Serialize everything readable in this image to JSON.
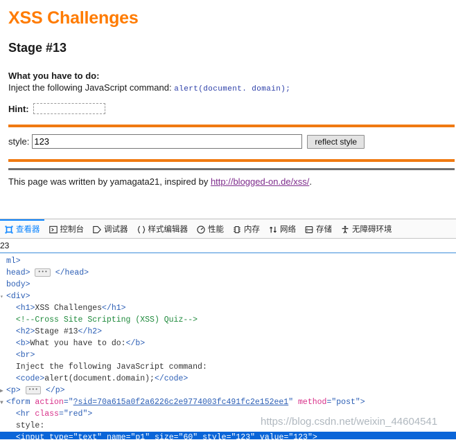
{
  "page": {
    "title": "XSS Challenges",
    "stage": "Stage #13",
    "task_label": "What you have to do:",
    "task_text": "Inject the following JavaScript command:",
    "task_code": "alert(document. domain);",
    "hint_label": "Hint:",
    "hint_value": "",
    "style_label": "style:",
    "style_value": "123",
    "reflect_button": "reflect style",
    "footer_text_before": "This page was written by yamagata21, inspired by ",
    "footer_link": "http://blogged-on.de/xss/",
    "footer_text_after": ".",
    "accent_color": "#ff7b00",
    "rule_red_color": "#f07a12",
    "rule_gray_color": "#6d6e71",
    "link_color": "#7d2b8b"
  },
  "devtools": {
    "tabs": [
      {
        "label": "查看器",
        "icon": "inspector-icon",
        "active": true
      },
      {
        "label": "控制台",
        "icon": "console-icon",
        "active": false
      },
      {
        "label": "调试器",
        "icon": "debugger-icon",
        "active": false
      },
      {
        "label": "样式编辑器",
        "icon": "style-editor-icon",
        "active": false
      },
      {
        "label": "性能",
        "icon": "performance-icon",
        "active": false
      },
      {
        "label": "内存",
        "icon": "memory-icon",
        "active": false
      },
      {
        "label": "网络",
        "icon": "network-icon",
        "active": false
      },
      {
        "label": "存储",
        "icon": "storage-icon",
        "active": false
      },
      {
        "label": "无障碍环境",
        "icon": "accessibility-icon",
        "active": false
      }
    ],
    "active_tab": "查看器",
    "search_value": "23",
    "accent_color": "#0a84ff",
    "selection_color": "#0a65d8",
    "markup": [
      {
        "id": "l1",
        "indent": 0,
        "parts": [
          {
            "t": "tg",
            "s": "ml>"
          }
        ]
      },
      {
        "id": "l2",
        "indent": 0,
        "parts": [
          {
            "t": "tg",
            "s": "head>"
          },
          {
            "t": "badge",
            "s": ""
          },
          {
            "t": "tg",
            "s": "</head>"
          }
        ]
      },
      {
        "id": "l3",
        "indent": 0,
        "parts": [
          {
            "t": "tg",
            "s": "body>"
          }
        ]
      },
      {
        "id": "l4",
        "indent": 0,
        "twisty": "down-dim",
        "parts": [
          {
            "t": "tg",
            "s": "<div>"
          }
        ]
      },
      {
        "id": "l5",
        "indent": 1,
        "parts": [
          {
            "t": "tg",
            "s": "<h1>"
          },
          {
            "t": "txt",
            "s": "XSS Challenges"
          },
          {
            "t": "tg",
            "s": "</h1>"
          }
        ]
      },
      {
        "id": "l6",
        "indent": 1,
        "parts": [
          {
            "t": "cmt",
            "s": "<!--Cross Site Scripting (XSS) Quiz-->"
          }
        ]
      },
      {
        "id": "l7",
        "indent": 1,
        "parts": [
          {
            "t": "tg",
            "s": "<h2>"
          },
          {
            "t": "txt",
            "s": "Stage #13"
          },
          {
            "t": "tg",
            "s": "</h2>"
          }
        ]
      },
      {
        "id": "l8",
        "indent": 1,
        "parts": [
          {
            "t": "tg",
            "s": "<b>"
          },
          {
            "t": "txt",
            "s": "What you have to do:"
          },
          {
            "t": "tg",
            "s": "</b>"
          }
        ]
      },
      {
        "id": "l9",
        "indent": 1,
        "parts": [
          {
            "t": "tg",
            "s": "<br>"
          }
        ]
      },
      {
        "id": "l10",
        "indent": 1,
        "parts": [
          {
            "t": "txt",
            "s": "Inject the following JavaScript command:"
          }
        ]
      },
      {
        "id": "l11",
        "indent": 1,
        "parts": [
          {
            "t": "tg",
            "s": "<code>"
          },
          {
            "t": "txt",
            "s": "alert(document.domain);"
          },
          {
            "t": "tg",
            "s": "</code>"
          }
        ]
      },
      {
        "id": "l12",
        "indent": 0,
        "twisty": "right",
        "parts": [
          {
            "t": "tg",
            "s": "<p>"
          },
          {
            "t": "badge",
            "s": ""
          },
          {
            "t": "tg",
            "s": "</p>"
          }
        ]
      },
      {
        "id": "l13",
        "indent": 0,
        "twisty": "down",
        "parts": [
          {
            "t": "tg",
            "s": "<form "
          },
          {
            "t": "attr",
            "s": "action"
          },
          {
            "t": "tg",
            "s": "=\""
          },
          {
            "t": "valul",
            "s": "?sid=70a615a0f2a6226c2e9774003fc491fc2e152ee1"
          },
          {
            "t": "tg",
            "s": "\" "
          },
          {
            "t": "attr",
            "s": "method"
          },
          {
            "t": "tg",
            "s": "=\""
          },
          {
            "t": "val",
            "s": "post"
          },
          {
            "t": "tg",
            "s": "\">"
          }
        ]
      },
      {
        "id": "l14",
        "indent": 1,
        "parts": [
          {
            "t": "tg",
            "s": "<hr "
          },
          {
            "t": "attr",
            "s": "class"
          },
          {
            "t": "tg",
            "s": "=\""
          },
          {
            "t": "val",
            "s": "red"
          },
          {
            "t": "tg",
            "s": "\">"
          }
        ]
      },
      {
        "id": "l15",
        "indent": 1,
        "parts": [
          {
            "t": "txt",
            "s": "style:"
          }
        ]
      },
      {
        "id": "l16",
        "indent": 1,
        "selected": true,
        "parts": [
          {
            "t": "tg",
            "s": "<input "
          },
          {
            "t": "attr",
            "s": "type"
          },
          {
            "t": "tg",
            "s": "=\""
          },
          {
            "t": "val",
            "s": "text"
          },
          {
            "t": "tg",
            "s": "\" "
          },
          {
            "t": "attr",
            "s": "name"
          },
          {
            "t": "tg",
            "s": "=\""
          },
          {
            "t": "val",
            "s": "p1"
          },
          {
            "t": "tg",
            "s": "\" "
          },
          {
            "t": "attr",
            "s": "size"
          },
          {
            "t": "tg",
            "s": "=\""
          },
          {
            "t": "val",
            "s": "60"
          },
          {
            "t": "tg",
            "s": "\" "
          },
          {
            "t": "attr",
            "s": "style"
          },
          {
            "t": "tg",
            "s": "=\""
          },
          {
            "t": "val",
            "s": "123"
          },
          {
            "t": "tg",
            "s": "\" "
          },
          {
            "t": "attr",
            "s": "value"
          },
          {
            "t": "tg",
            "s": "=\""
          },
          {
            "t": "val",
            "s": "123"
          },
          {
            "t": "tg",
            "s": "\">"
          }
        ]
      }
    ]
  },
  "watermark": "https://blog.csdn.net/weixin_44604541"
}
